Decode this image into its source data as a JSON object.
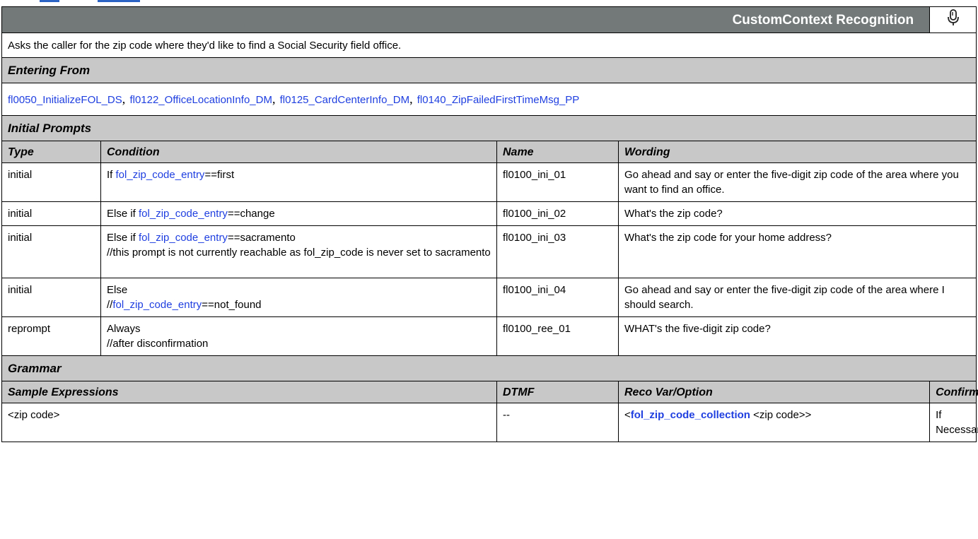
{
  "header": {
    "title": "CustomContext Recognition",
    "icon": "microphone-icon"
  },
  "description": "Asks the caller for the zip code where they'd like to find a Social Security field office.",
  "entering_from": {
    "label": "Entering From",
    "links": [
      "fl0050_InitializeFOL_DS",
      "fl0122_OfficeLocationInfo_DM",
      "fl0125_CardCenterInfo_DM",
      "fl0140_ZipFailedFirstTimeMsg_PP"
    ],
    "separator": ","
  },
  "initial_prompts": {
    "label": "Initial Prompts",
    "columns": {
      "type": "Type",
      "condition": "Condition",
      "name": "Name",
      "wording": "Wording"
    },
    "rows": [
      {
        "type": "initial",
        "cond_pre": "If ",
        "cond_link": "fol_zip_code_entry",
        "cond_post": "==first",
        "cond_note": "",
        "name": "fl0100_ini_01",
        "wording": "Go ahead and say or enter the five-digit zip code of the area where you want to find an office."
      },
      {
        "type": "initial",
        "cond_pre": "Else if ",
        "cond_link": "fol_zip_code_entry",
        "cond_post": "==change",
        "cond_note": "",
        "name": "fl0100_ini_02",
        "wording": "What's the zip code?"
      },
      {
        "type": "initial",
        "cond_pre": "Else if ",
        "cond_link": "fol_zip_code_entry",
        "cond_post": "==sacramento",
        "cond_note": "//this prompt is not currently reachable as fol_zip_code is never set to sacramento",
        "name": "fl0100_ini_03",
        "wording": "What's the zip code for your home address?"
      },
      {
        "type": "initial",
        "cond_line1": "Else",
        "cond_pre": "//",
        "cond_link": "fol_zip_code_entry",
        "cond_post": "==not_found",
        "name": "fl0100_ini_04",
        "wording": "Go ahead and say or enter the five-digit zip code of the area where I should search."
      },
      {
        "type": "reprompt",
        "cond_line1": "Always",
        "cond_line2": "//after disconfirmation",
        "name": "fl0100_ree_01",
        "wording": "WHAT's the five-digit zip code?"
      }
    ]
  },
  "grammar": {
    "label": "Grammar",
    "columns": {
      "sample": "Sample Expressions",
      "dtmf": "DTMF",
      "reco": "Reco Var/Option",
      "confirm": "Confirm"
    },
    "rows": [
      {
        "sample": "<zip code>",
        "dtmf": "--",
        "reco_pre": "<",
        "reco_link": "fol_zip_code_collection",
        "reco_post": " <zip code>>",
        "confirm": "If Necessary"
      }
    ]
  }
}
